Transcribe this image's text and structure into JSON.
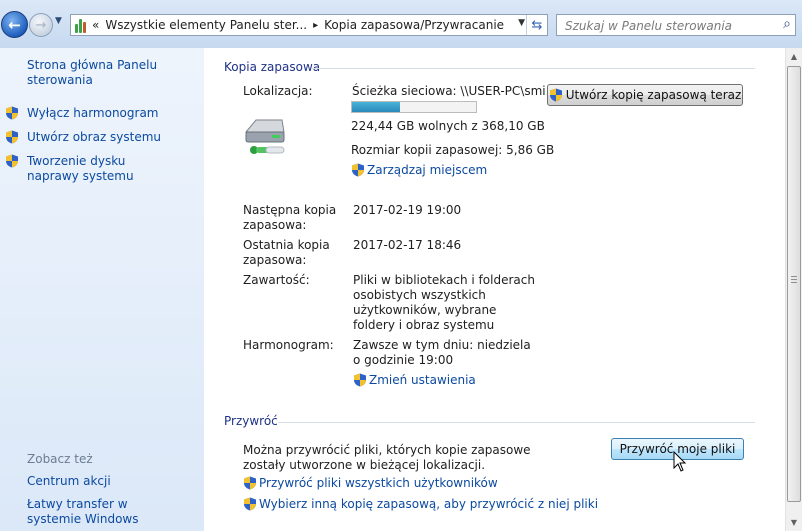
{
  "addressbar": {
    "overflow": "«",
    "crumbs": [
      "Wszystkie elementy Panelu ster...",
      "Kopia zapasowa/Przywracanie"
    ],
    "separator": "▸",
    "search_placeholder": "Szukaj w Panelu sterowania"
  },
  "icons": {
    "back": "arrow-left-icon",
    "forward": "arrow-right-icon",
    "dropdown": "chevron-down-icon",
    "refresh": "refresh-icon",
    "search": "magnifier-icon",
    "shield": "uac-shield-icon",
    "drive": "backup-drive-icon",
    "control_panel": "control-panel-icon"
  },
  "sidebar": {
    "home": "Strona główna Panelu sterowania",
    "tasks": [
      {
        "label": "Wyłącz harmonogram"
      },
      {
        "label": "Utwórz obraz systemu"
      },
      {
        "label": "Tworzenie dysku naprawy systemu"
      }
    ],
    "see_also_title": "Zobacz też",
    "see_also": [
      {
        "label": "Centrum akcji"
      },
      {
        "label": "Łatwy transfer w systemie Windows"
      }
    ]
  },
  "backup": {
    "group_title": "Kopia zapasowa",
    "location_label": "Lokalizacja:",
    "location_value": "Ścieżka sieciowa: \\\\USER-PC\\smi...",
    "backup_now_button": "Utwórz kopię zapasową teraz",
    "drive_usage_fraction": 0.39,
    "free_space": "224,44 GB wolnych z 368,10 GB",
    "backup_size": "Rozmiar kopii zapasowej: 5,86 GB",
    "manage_space_link": "Zarządzaj miejscem",
    "next_label": "Następna kopia zapasowa:",
    "next_value": "2017-02-19 19:00",
    "last_label": "Ostatnia kopia zapasowa:",
    "last_value": "2017-02-17 18:46",
    "contents_label": "Zawartość:",
    "contents_value": "Pliki w bibliotekach i folderach osobistych wszystkich użytkowników, wybrane foldery i obraz systemu",
    "schedule_label": "Harmonogram:",
    "schedule_value": "Zawsze w tym dniu: niedziela o godzinie 19:00",
    "change_settings_link": "Zmień ustawienia"
  },
  "restore": {
    "group_title": "Przywróć",
    "description": "Można przywrócić pliki, których kopie zapasowe zostały utworzone w bieżącej lokalizacji.",
    "restore_my_files_button": "Przywróć moje pliki",
    "restore_all_users_link": "Przywróć pliki wszystkich użytkowników",
    "choose_other_backup_link": "Wybierz inną kopię zapasową, aby przywrócić z niej pliki"
  }
}
